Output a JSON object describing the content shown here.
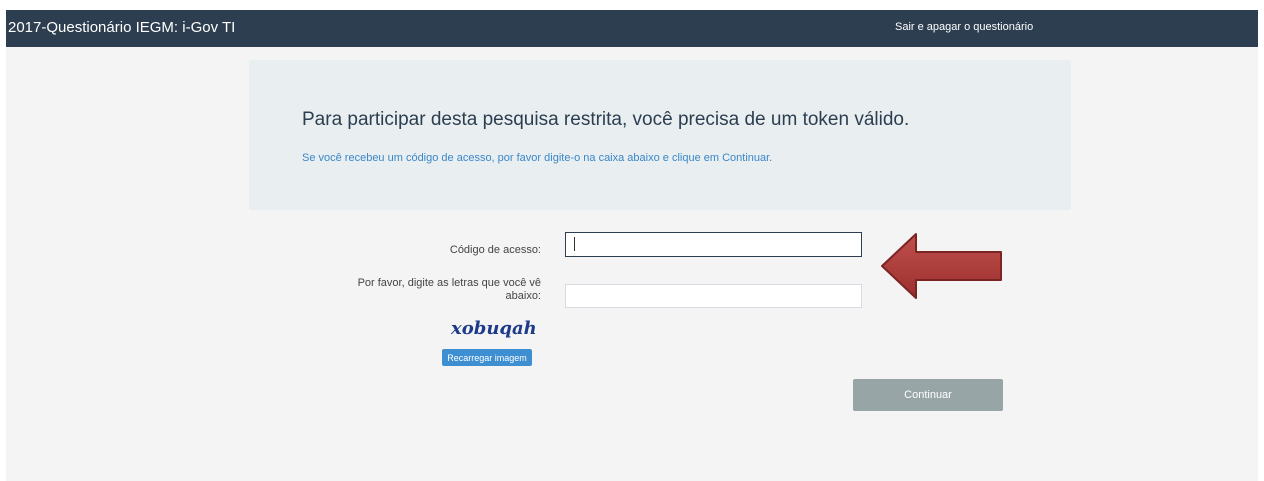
{
  "header": {
    "title": "2017-Questionário IEGM: i-Gov TI",
    "exit_link": "Sair e apagar o questionário"
  },
  "alert": {
    "title": "Para participar desta pesquisa restrita, você precisa de um token válido.",
    "text": "Se você recebeu um código de acesso, por favor digite-o na caixa abaixo e clique em Continuar."
  },
  "form": {
    "access_code_label": "Código de acesso:",
    "access_code_value": "",
    "captcha_label": "Por favor, digite as letras que você vê abaixo:",
    "captcha_value": "",
    "captcha_text": "xobuqah",
    "reload_label": "Recarregar imagem",
    "continue_label": "Continuar"
  },
  "colors": {
    "header_bg": "#2c3e50",
    "link": "#3a87c8",
    "reload_btn": "#3d8fd1",
    "continue_btn": "#97a5a6",
    "arrow": "#b03a3a"
  },
  "annotation": {
    "arrow_icon": "left-arrow-icon"
  }
}
